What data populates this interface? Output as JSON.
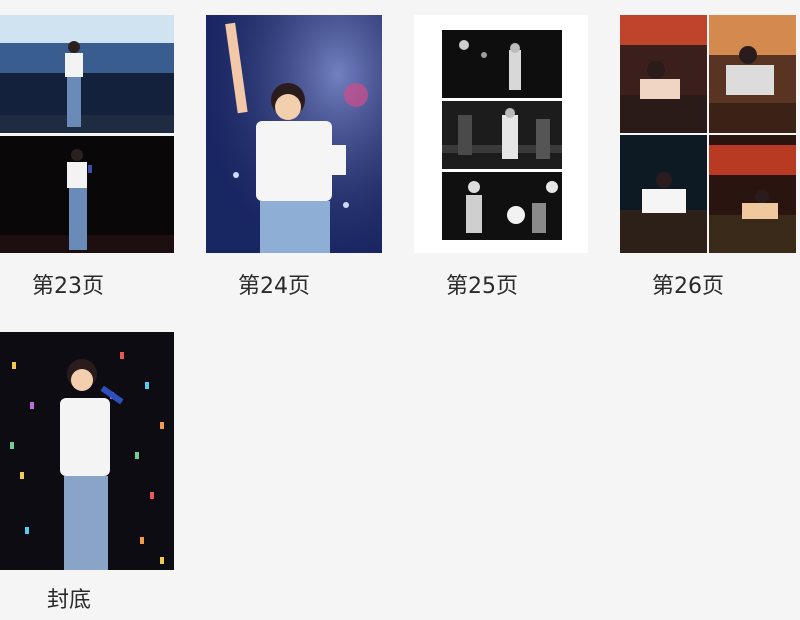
{
  "pages": [
    {
      "label": "第23页",
      "thumbnail": "two-concert-photos-stacked"
    },
    {
      "label": "第24页",
      "thumbnail": "single-concert-photo-waving"
    },
    {
      "label": "第25页",
      "thumbnail": "three-black-and-white-photos"
    },
    {
      "label": "第26页",
      "thumbnail": "four-photo-grid-sitting-with-mic"
    },
    {
      "label": "封底",
      "thumbnail": "single-concert-photo-confetti"
    }
  ],
  "colors": {
    "background": "#f5f5f6",
    "label_text": "#2a2a2a"
  }
}
